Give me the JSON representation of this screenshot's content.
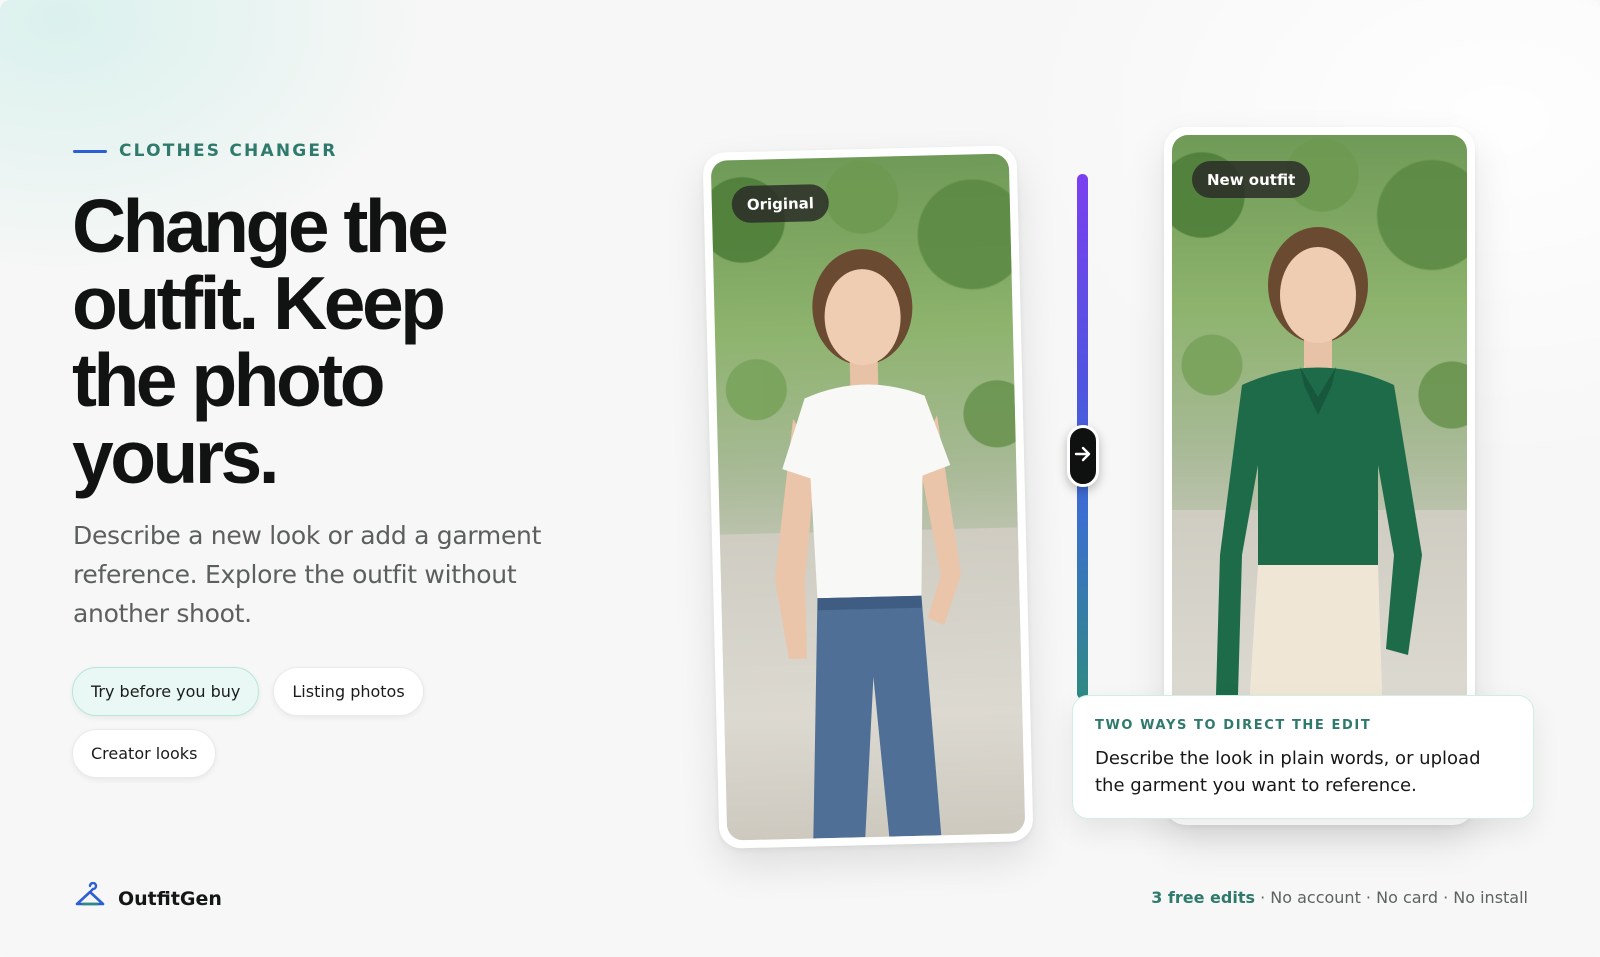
{
  "eyebrow": {
    "label": "CLOTHES CHANGER"
  },
  "hero": {
    "headline_lines": [
      "Change the",
      "outfit. Keep",
      "the photo",
      "yours."
    ],
    "subhead": "Describe a new look or add a garment reference. Explore the outfit without another shoot."
  },
  "chips": [
    {
      "label": "Try before you buy",
      "active": true
    },
    {
      "label": "Listing photos",
      "active": false
    },
    {
      "label": "Creator looks",
      "active": false
    }
  ],
  "compare": {
    "before_badge": "Original",
    "after_badge": "New outfit",
    "slider_icon": "arrow-right-icon"
  },
  "info_card": {
    "title": "TWO WAYS TO DIRECT THE EDIT",
    "body": "Describe the look in plain words, or upload the garment you want to reference."
  },
  "brand": {
    "name": "OutfitGen",
    "icon": "hanger-icon"
  },
  "footer": {
    "highlight": "3 free edits",
    "rest": " · No account · No card · No install"
  },
  "colors": {
    "accent_teal": "#2f7a6c",
    "accent_blue": "#2d5fd4",
    "slider_top": "#7b3ff0",
    "slider_bottom": "#2f8a82",
    "chip_active_bg": "#e9f8f4"
  }
}
